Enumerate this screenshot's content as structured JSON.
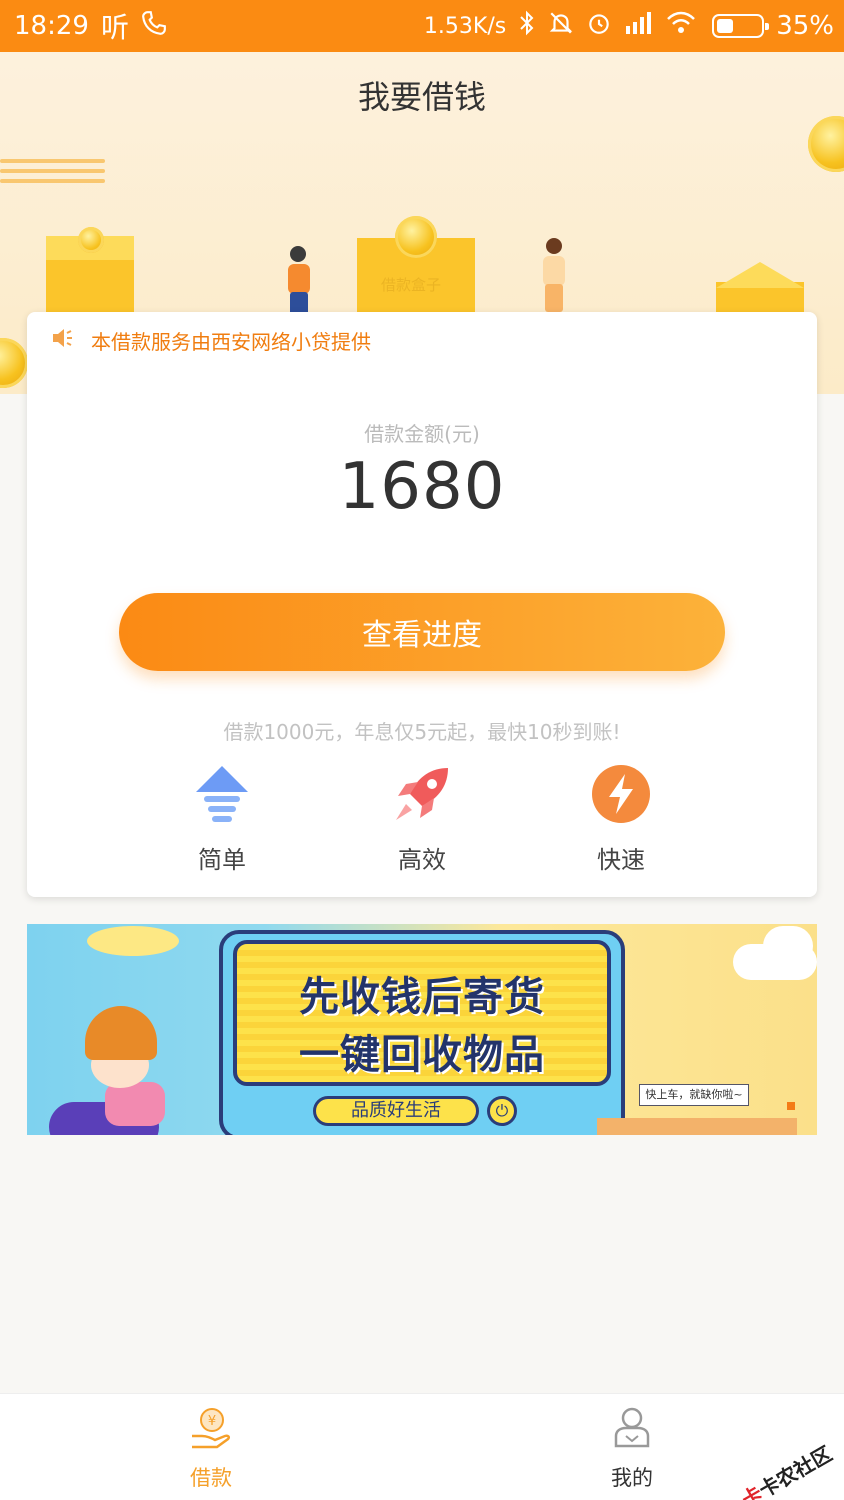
{
  "status_bar": {
    "time": "18:29",
    "carrier_glyph": "听",
    "net_speed": "1.53K/s",
    "battery": "35%",
    "icons": [
      "phone-call-icon",
      "bluetooth-icon",
      "mute-icon",
      "alarm-icon",
      "signal-icon",
      "wifi-icon",
      "battery-icon"
    ]
  },
  "header": {
    "title": "我要借钱",
    "box_label": "借款盒子"
  },
  "card": {
    "notice": "本借款服务由西安网络小贷提供",
    "amount_label": "借款金额(元)",
    "amount": "1680",
    "progress_button": "查看进度",
    "tagline": "借款1000元，年息仅5元起，最快10秒到账!",
    "features": [
      {
        "label": "简单",
        "icon": "arrow-up-icon",
        "color": "#6d9bf5"
      },
      {
        "label": "高效",
        "icon": "rocket-icon",
        "color": "#f05b5b"
      },
      {
        "label": "快速",
        "icon": "lightning-icon",
        "color": "#f48a3d"
      }
    ]
  },
  "banner": {
    "line1": "先收钱后寄货",
    "line2": "一键回收物品",
    "pill": "品质好生活",
    "speech": "快上车，就缺你啦~"
  },
  "bottom_nav": {
    "items": [
      {
        "label": "借款",
        "icon": "loan-hand-coin-icon",
        "active": true
      },
      {
        "label": "我的",
        "icon": "user-profile-icon",
        "active": false
      }
    ],
    "active_color": "#f5a02a",
    "inactive_color": "#333333"
  },
  "watermark": {
    "mark": "卡",
    "text": "卡农社区"
  },
  "colors": {
    "accent": "#fb8b12",
    "notice": "#f07d10"
  }
}
